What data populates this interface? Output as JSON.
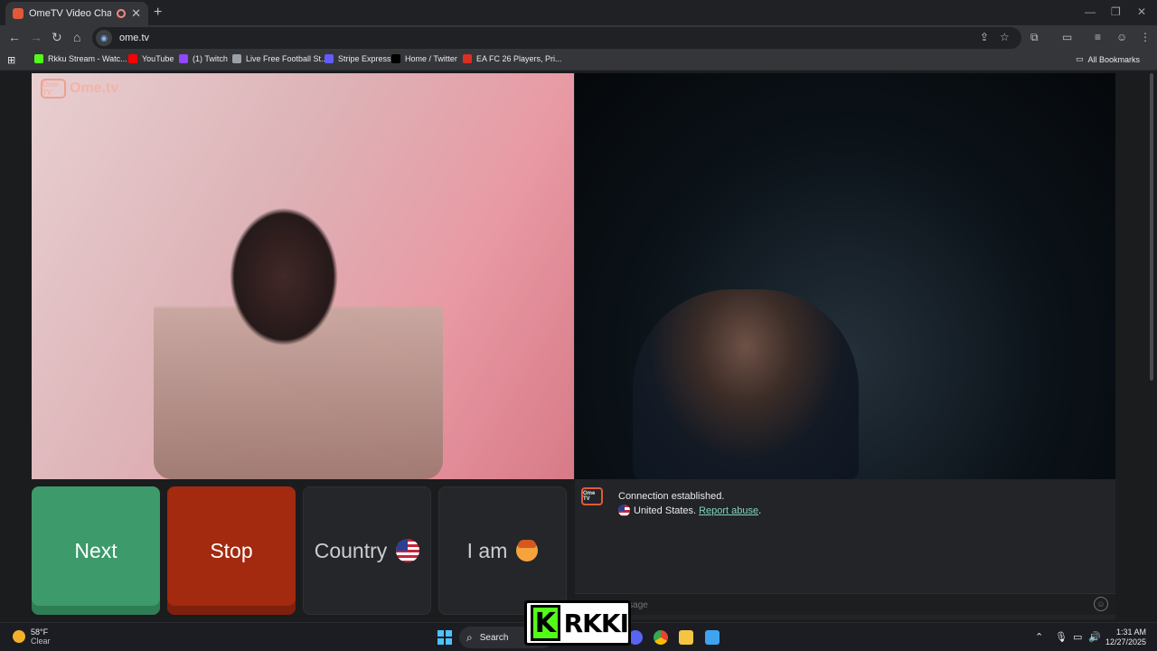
{
  "browser": {
    "tab_title": "OmeTV Video Chat — Ome",
    "new_tab": "+",
    "url": "ome.tv",
    "bookmarks": [
      {
        "label": "Rkku Stream - Watc...",
        "color": "#53fc18"
      },
      {
        "label": "YouTube",
        "color": "#ff0000"
      },
      {
        "label": "(1) Twitch",
        "color": "#9146ff"
      },
      {
        "label": "Live Free Football St...",
        "color": "#9aa0a6"
      },
      {
        "label": "Stripe Express",
        "color": "#635bff"
      },
      {
        "label": "Home / Twitter",
        "color": "#000000"
      },
      {
        "label": "EA FC 26 Players, Pri...",
        "color": "#d93025"
      }
    ],
    "all_bookmarks": "All Bookmarks"
  },
  "ometv": {
    "logo_box": "Ome TV",
    "logo_text": "Ome.tv",
    "buttons": {
      "next": "Next",
      "stop": "Stop",
      "country": "Country",
      "iam": "I am"
    },
    "chat": {
      "logo_box": "Ome TV",
      "message1": "Connection established.",
      "country": "United States.",
      "report": "Report abuse",
      "period": ".",
      "input_placeholder": "Write a message"
    }
  },
  "overlay": {
    "kick_badge": "K",
    "kick_name": "RKKI"
  },
  "taskbar": {
    "weather_temp": "58°F",
    "weather_cond": "Clear",
    "search_label": "Search",
    "time": "1:31 AM",
    "date": "12/27/2025"
  },
  "colors": {
    "next": "#3d9a6a",
    "stop": "#a3290f",
    "link": "#7fd3c0",
    "kick": "#53fc18"
  }
}
